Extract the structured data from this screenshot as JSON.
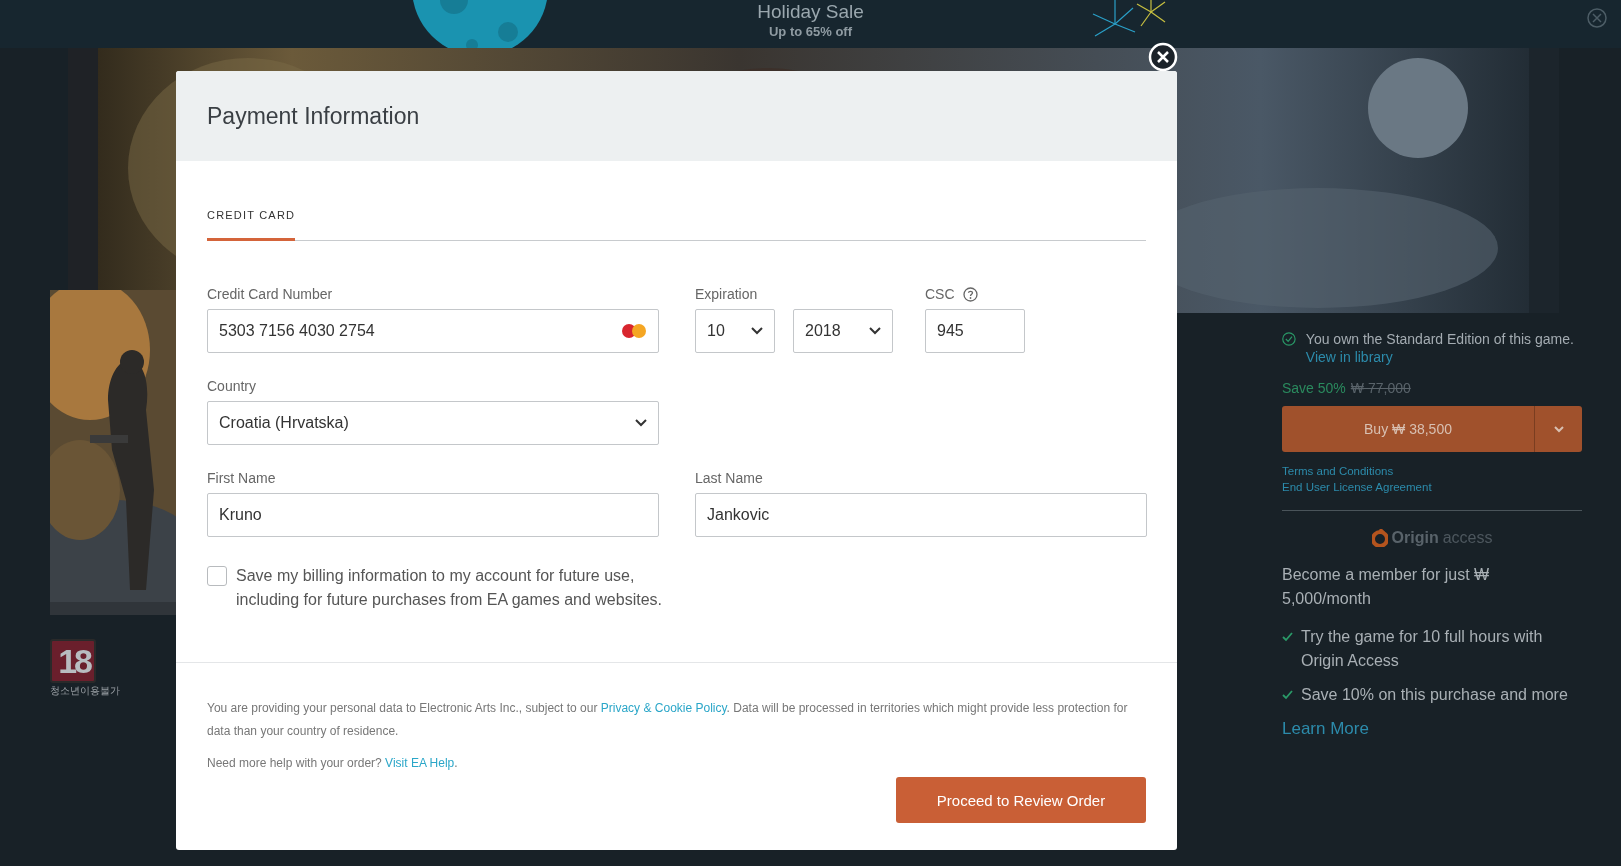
{
  "banner": {
    "title": "Holiday Sale",
    "subtitle": "Up to 65% off"
  },
  "product": {
    "rating": {
      "age": "18",
      "label": "청소년이용불가"
    },
    "ownership": {
      "text": "You own the Standard Edition of this game. ",
      "link": "View in library"
    },
    "discount": "Save 50%",
    "original_price": "₩ 77,000",
    "buy_button": "Buy ₩ 38,500",
    "links": [
      "Terms and Conditions",
      "End User License Agreement"
    ],
    "access": {
      "logo_word": "Origin",
      "logo_suffix": "access",
      "headline": "Become a member for just ₩ 5,000/month",
      "benefits": [
        "Try the game for 10 full hours with Origin Access",
        "Save 10% on this purchase and more"
      ],
      "learn_more": "Learn More"
    }
  },
  "modal": {
    "title": "Payment Information",
    "tabs": [
      {
        "label": "CREDIT CARD",
        "selected": true
      }
    ],
    "card_number": {
      "label": "Credit Card Number",
      "value": "5303 7156 4030 2754"
    },
    "expiration": {
      "label": "Expiration",
      "month": "10",
      "year": "2018"
    },
    "csc": {
      "label": "CSC",
      "value": "945"
    },
    "country": {
      "label": "Country",
      "value": "Croatia (Hrvatska)"
    },
    "first_name": {
      "label": "First Name",
      "value": "Kruno"
    },
    "last_name": {
      "label": "Last Name",
      "value": "Jankovic"
    },
    "save_billing": {
      "text": "Save my billing information to my account for future use, including for future purchases from EA games and websites.",
      "checked": false
    },
    "notice": {
      "before": "You are providing your personal data to Electronic Arts Inc., subject to our ",
      "link": "Privacy & Cookie Policy",
      "after": ". Data will be processed in territories which might provide less protection for data than your country of residence."
    },
    "help": {
      "before": "Need more help with your order? ",
      "link": "Visit EA Help",
      "after": "."
    },
    "submit": "Proceed to Review Order"
  }
}
